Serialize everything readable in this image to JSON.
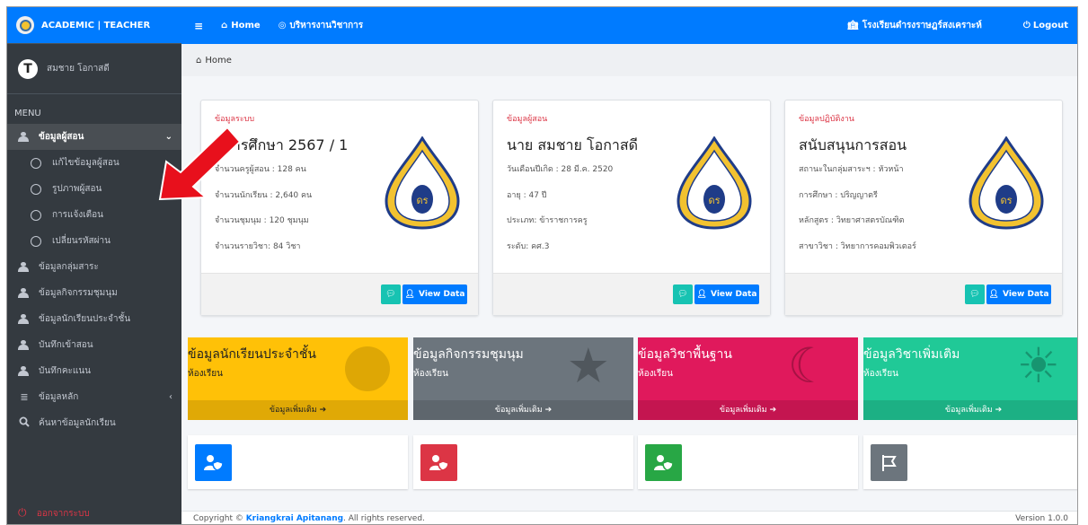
{
  "brand": {
    "title": "ACADEMIC | TEACHER"
  },
  "user": {
    "initial": "T",
    "name": "สมชาย โอกาสดี"
  },
  "menu_header": "MENU",
  "sidebar": {
    "items": [
      {
        "label": "ข้อมูลผู้สอน"
      },
      {
        "label": "แก้ไขข้อมูลผู้สอน"
      },
      {
        "label": "รูปภาพผู้สอน"
      },
      {
        "label": "การแจ้งเตือน"
      },
      {
        "label": "เปลี่ยนรหัสผ่าน"
      },
      {
        "label": "ข้อมูลกลุ่มสาระ"
      },
      {
        "label": "ข้อมูลกิจกรรมชุมนุม"
      },
      {
        "label": "ข้อมูลนักเรียนประจำชั้น"
      },
      {
        "label": "บันทึกเข้าสอน"
      },
      {
        "label": "บันทึกคะแนน"
      },
      {
        "label": "ข้อมูลหลัก"
      },
      {
        "label": "ค้นหาข้อมูลนักเรียน"
      }
    ],
    "logout": "ออกจากระบบ"
  },
  "topbar": {
    "home": "Home",
    "service": "บริหารงานวิชาการ",
    "school": "โรงเรียนดำรงราษฎร์สงเคราะห์",
    "logout": "Logout"
  },
  "breadcrumb": "Home",
  "cards": [
    {
      "header": "ข้อมูลระบบ",
      "title": "ปีการศึกษา 2567  / 1",
      "lines": [
        "จำนวนครูผู้สอน : 128 คน",
        "จำนวนนักเรียน : 2,640 คน",
        "จำนวนชุมนุม : 120 ชุมนุม",
        "จำนวนรายวิชา: 84 วิชา"
      ]
    },
    {
      "header": "ข้อมูลผู้สอน",
      "title": "นาย สมชาย  โอกาสดี",
      "lines": [
        "วันเดือนปีเกิด : 28 มี.ค. 2520",
        "อายุ : 47 ปี",
        "ประเภท: ข้าราชการครู",
        "ระดับ: คศ.3"
      ]
    },
    {
      "header": "ข้อมูลปฏิบัติงาน",
      "title": "สนับสนุนการสอน",
      "lines": [
        "สถานะในกลุ่มสาระฯ : หัวหน้า",
        "การศึกษา : ปริญญาตรี",
        "หลักสูตร : วิทยาศาสตรบัณฑิต",
        "สาขาวิชา : วิทยาการคอมพิวเตอร์"
      ]
    }
  ],
  "view_data_label": "View Data",
  "boxes": [
    {
      "title": "ข้อมูลนักเรียนประจำชั้น",
      "sub": "ห้องเรียน",
      "more": "ข้อมูลเพิ่มเติม",
      "color": "#ffc107"
    },
    {
      "title": "ข้อมูลกิจกรรมชุมนุม",
      "sub": "ห้องเรียน",
      "more": "ข้อมูลเพิ่มเติม",
      "color": "#6c757d"
    },
    {
      "title": "ข้อมูลวิชาพื้นฐาน",
      "sub": "ห้องเรียน",
      "more": "ข้อมูลเพิ่มเติม",
      "color": "#e0195c"
    },
    {
      "title": "ข้อมูลวิชาเพิ่มเติม",
      "sub": "ห้องเรียน",
      "more": "ข้อมูลเพิ่มเติม",
      "color": "#20c997"
    }
  ],
  "tiles": [
    {
      "icon": "user-shield-icon",
      "color": "#007bff"
    },
    {
      "icon": "user-shield-icon",
      "color": "#dc3545"
    },
    {
      "icon": "user-shield-icon",
      "color": "#28a745"
    },
    {
      "icon": "flag-icon",
      "color": "#6c757d"
    }
  ],
  "footer": {
    "prefix": "Copyright © ",
    "author": "Kriangkrai Apitanang",
    "suffix": ". All rights reserved.",
    "version": "Version 1.0.0"
  }
}
